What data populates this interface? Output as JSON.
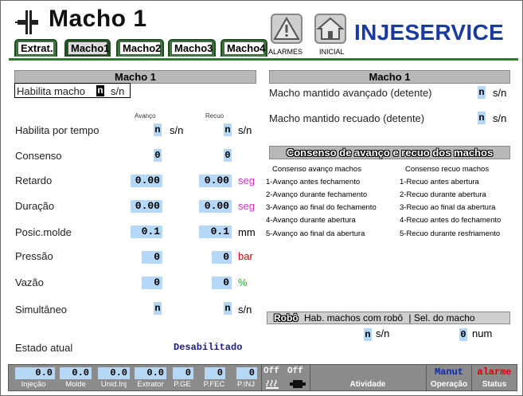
{
  "header": {
    "title": "Macho 1",
    "brand": "INJESERVICE",
    "tabs": [
      {
        "label": "Extrat."
      },
      {
        "label": "Macho1"
      },
      {
        "label": "Macho2"
      },
      {
        "label": "Macho3"
      },
      {
        "label": "Macho4"
      }
    ],
    "alarmes_label": "ALARMES",
    "inicial_label": "INICIAL"
  },
  "left": {
    "section_title": "Macho 1",
    "habilita_macho": {
      "label": "Habilita macho",
      "value": "n",
      "unit": "s/n"
    },
    "col_avanco": "Avanço",
    "col_recuo": "Recuo",
    "rows": {
      "habilita_tempo": {
        "label": "Habilita por tempo",
        "avanco": "n",
        "avanco_unit": "s/n",
        "recuo": "n",
        "recuo_unit": "s/n"
      },
      "consenso": {
        "label": "Consenso",
        "avanco": "0",
        "recuo": "0"
      },
      "retardo": {
        "label": "Retardo",
        "avanco": "0.00",
        "recuo": "0.00",
        "unit": "seg"
      },
      "duracao": {
        "label": "Duração",
        "avanco": "0.00",
        "recuo": "0.00",
        "unit": "seg"
      },
      "posic_molde": {
        "label": "Posic.molde",
        "avanco": "0.1",
        "recuo": "0.1",
        "unit": "mm"
      },
      "pressao": {
        "label": "Pressão",
        "avanco": "0",
        "recuo": "0",
        "unit": "bar"
      },
      "vazao": {
        "label": "Vazão",
        "avanco": "0",
        "recuo": "0",
        "unit": "%"
      },
      "simultaneo": {
        "label": "Simultâneo",
        "avanco": "n",
        "recuo": "n",
        "unit": "s/n"
      }
    },
    "estado_label": "Estado atual",
    "estado_value": "Desabilitado"
  },
  "right": {
    "section_title": "Macho 1",
    "mantido_avancado": {
      "label": "Macho mantido avançado (detente)",
      "value": "n",
      "unit": "s/n"
    },
    "mantido_recuado": {
      "label": "Macho mantido recuado (detente)",
      "value": "n",
      "unit": "s/n"
    },
    "consenso_title": "Consenso de avanço e recuo dos machos",
    "consenso_avanco_title": "Consenso avanço machos",
    "consenso_recuo_title": "Consenso recuo machos",
    "consenso_avanco": [
      "1-Avanço antes fechamento",
      "2-Avanço durante fechamento",
      "3-Avanço ao final do fechamento",
      "4-Avanço durante abertura",
      "5-Avanço ao final da abertura"
    ],
    "consenso_recuo": [
      "1-Recuo antes abertura",
      "2-Recuo durante abertura",
      "3-Recuo ao final da abertura",
      "4-Recuo antes do fechamento",
      "5-Recuo durante resfriamento"
    ],
    "robo_title": "Robô",
    "robo_hab": "Hab. machos com robô",
    "robo_sel": "| Sel. do macho",
    "robo_hab_value": "n",
    "robo_hab_unit": "s/n",
    "robo_sel_value": "0",
    "robo_sel_unit": "num"
  },
  "status": {
    "injecao": {
      "value": "0.0",
      "label": "Injeção"
    },
    "molde": {
      "value": "0.0",
      "label": "Molde"
    },
    "unid_inj": {
      "value": "0.0",
      "label": "Unid.Inj"
    },
    "extrator": {
      "value": "0.0",
      "label": "Extrator"
    },
    "p_ge": {
      "value": "0",
      "label": "P.GE"
    },
    "p_fec": {
      "value": "0",
      "label": "P.FEC"
    },
    "p_inj": {
      "value": "0",
      "label": "P.INJ"
    },
    "off1": "Off",
    "off2": "Off",
    "atividade": "Atividade",
    "operacao_value": "Manut",
    "operacao_label": "Operação",
    "status_value": "alarme",
    "status_label": "Status"
  },
  "colors": {
    "input_bg": "#b6d7f5",
    "brand": "#1a3aa0",
    "tab_green": "#3b7d3b",
    "unit_seg": "#cc33cc",
    "unit_bar": "#cc0000",
    "unit_pct": "#22aa22",
    "estado": "#1a1a8a"
  }
}
